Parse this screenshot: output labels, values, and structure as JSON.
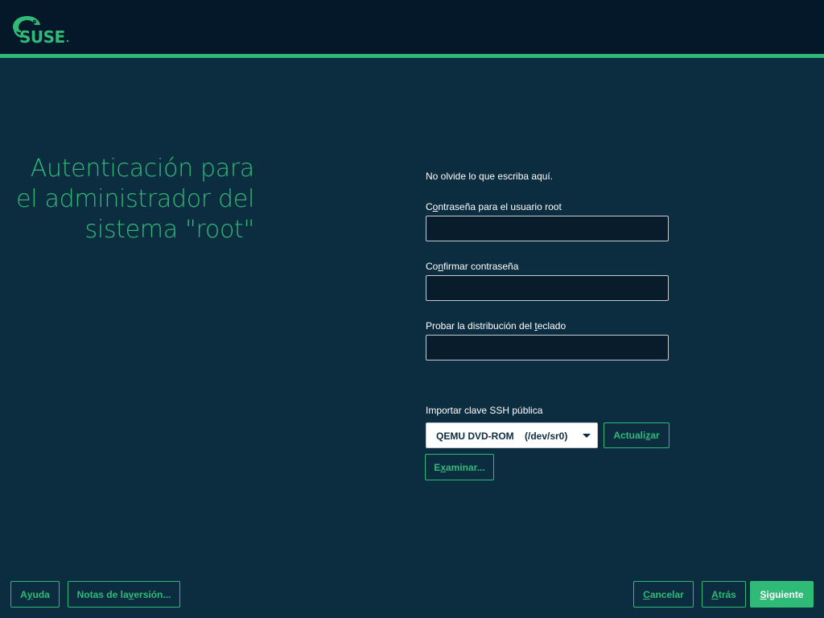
{
  "header": {
    "logo_text": "SUSE",
    "brand_color": "#30ba78",
    "background_color": "#04182a"
  },
  "page": {
    "title": "Autenticación para el administrador del sistema \"root\"",
    "background_color": "#0c2c40"
  },
  "form": {
    "hint": "No olvide lo que escriba aquí.",
    "password": {
      "label_pre": "C",
      "label_mnemonic": "o",
      "label_post": "ntraseña para el usuario root",
      "value": ""
    },
    "confirm": {
      "label_pre": "Co",
      "label_mnemonic": "n",
      "label_post": "firmar contraseña",
      "value": ""
    },
    "keyboard_test": {
      "label_pre": "Probar la distribución del ",
      "label_mnemonic": "t",
      "label_post": "eclado",
      "value": ""
    },
    "ssh": {
      "label": "Importar clave SSH pública",
      "device_selected": "QEMU DVD-ROM    (/dev/sr0)",
      "refresh_pre": "Actuali",
      "refresh_mnemonic": "z",
      "refresh_post": "ar",
      "browse_pre": "E",
      "browse_mnemonic": "x",
      "browse_post": "aminar..."
    }
  },
  "footer": {
    "help": {
      "pre": "A",
      "mnemonic": "y",
      "post": "uda"
    },
    "release_notes": {
      "pre": "Notas de la ",
      "mnemonic": "v",
      "post": "ersión..."
    },
    "cancel": {
      "pre": "",
      "mnemonic": "C",
      "post": "ancelar"
    },
    "back": {
      "pre": "",
      "mnemonic": "A",
      "post": "trás"
    },
    "next": {
      "pre": "",
      "mnemonic": "S",
      "post": "iguiente"
    }
  }
}
